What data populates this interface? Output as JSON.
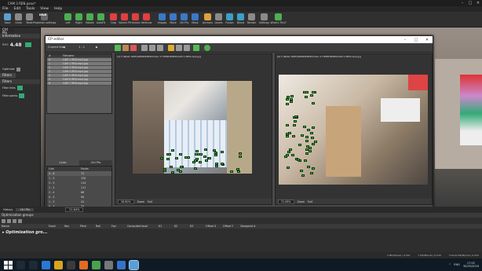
{
  "window": {
    "title": "CAM 3 REN.pano*",
    "min": "–",
    "max": "□",
    "close": "✕"
  },
  "menu": [
    "File",
    "Edit",
    "Tools",
    "View",
    "Help"
  ],
  "toolbar": {
    "items": [
      {
        "label": "Save",
        "color": "#5a9fd4"
      },
      {
        "label": "Undo",
        "color": "#8a8a8a"
      },
      {
        "label": "Redo",
        "color": "#8a8a8a"
      },
      {
        "label": "Projection settings",
        "color": "#666666",
        "badge": "Kfull"
      },
      {
        "label": "Left",
        "color": "#4caf50"
      },
      {
        "label": "Right",
        "color": "#4caf50"
      },
      {
        "label": "Rotate",
        "color": "#4caf50"
      },
      {
        "label": "AutoFit",
        "color": "#4caf50"
      },
      {
        "label": "Crop",
        "color": "#e04040"
      },
      {
        "label": "Vanish Pt",
        "color": "#e04040"
      },
      {
        "label": "Horizon",
        "color": "#e04040"
      },
      {
        "label": "Verticals",
        "color": "#e04040"
      },
      {
        "label": "Images",
        "color": "#3a78c8"
      },
      {
        "label": "Move",
        "color": "#3a78c8"
      },
      {
        "label": "Ctrl Pts",
        "color": "#3a78c8"
      },
      {
        "label": "Mask",
        "color": "#3a78c8"
      },
      {
        "label": "Anchors",
        "color": "#e0a040"
      },
      {
        "label": "Levels",
        "color": "#8a8a8a"
      },
      {
        "label": "Fusion",
        "color": "#3aa0c8"
      },
      {
        "label": "Blend",
        "color": "#3aa0c8"
      },
      {
        "label": "Render",
        "color": "#8a8a8a"
      },
      {
        "label": "Settings",
        "color": "#8a8a8a"
      },
      {
        "label": "What's This?",
        "color": "#4caf50"
      }
    ]
  },
  "leftpanel": {
    "tab": "Ctrl Pts",
    "information": "Information",
    "rms_label": "RMS",
    "rms_value": "4.48",
    "optimize_label": "Optimize",
    "filters_tab": "Filters",
    "filters_header": "Filters",
    "filter_links": "Filter links",
    "filter_points": "Filter points"
  },
  "dialog": {
    "title": "CP editor",
    "current_link_label": "Current link",
    "current_link_value": "1 - 1",
    "files": {
      "headers": [
        "#",
        "Filename"
      ],
      "rows": [
        [
          "0",
          "CAM 1 REN.mp4.jpg"
        ],
        [
          "1",
          "CAM 2 REN.mp4.jpg"
        ],
        [
          "2",
          "CAM 3 REN.mp4.jpg"
        ],
        [
          "3",
          "CAM 4 REN.mp4.jpg"
        ],
        [
          "4",
          "CAM 5 REN.mp4.jpg"
        ],
        [
          "5",
          "CAM 6 REN.mp4.jpg"
        ],
        [
          "6",
          "CAM 7 REN.mp4.jpg"
        ]
      ]
    },
    "link_tabs": [
      "Links",
      "Ctrl Pts"
    ],
    "links": {
      "headers": [
        "Link",
        "Points"
      ],
      "rows": [
        [
          "4 - 6",
          "72"
        ],
        [
          "1 - 5",
          "150"
        ],
        [
          "3 - 5",
          "114"
        ],
        [
          "1 - 2",
          "111"
        ],
        [
          "2 - 4",
          "68"
        ],
        [
          "0 - 5",
          "90"
        ],
        [
          "1 - 3",
          "41"
        ],
        [
          "0 - 3",
          "29"
        ],
        [
          "3 - 4",
          "47"
        ],
        [
          "0 - 2",
          "41"
        ],
        [
          "2 - 3",
          "24"
        ]
      ]
    },
    "left_image": {
      "path": "[1] F:\\NAVA ODE\\VRENDERED\\Video 17 RENDERED\\CAM 1 REN.mp4.jpg",
      "zoom": "26.60%",
      "zoom_btn": "Zoom",
      "extra": "Exif"
    },
    "right_image": {
      "path": "[0] F:\\NAVA ODE\\VRENDERED\\Video 17 RENDERED\\CAM 2 REN.mp4.jpg",
      "zoom": "31.08%",
      "zoom_btn": "Zoom",
      "extra": "Exif"
    }
  },
  "bottom": {
    "tabs": [
      "History",
      "Ctrl Pts"
    ],
    "zoom": "21.84%",
    "opt_header": "Optimization groups",
    "columns": [
      "Name",
      "Focal",
      "Ifov",
      "Pitch",
      "Roll",
      "Fov",
      "Computed focal",
      "K1",
      "K2",
      "K3",
      "Offset X",
      "Offset Y",
      "Viewpoint d"
    ],
    "group": "Optimization gro..."
  },
  "status": {
    "items": [
      "4 Mb/Mpixel | 0.032",
      "7 Mb/Mpixel | 0.032",
      "Theme Mb/Mpixel | 0.032"
    ]
  },
  "taskbar": {
    "lang": "ENG",
    "time": "17:02",
    "date": "30/05/2016"
  }
}
